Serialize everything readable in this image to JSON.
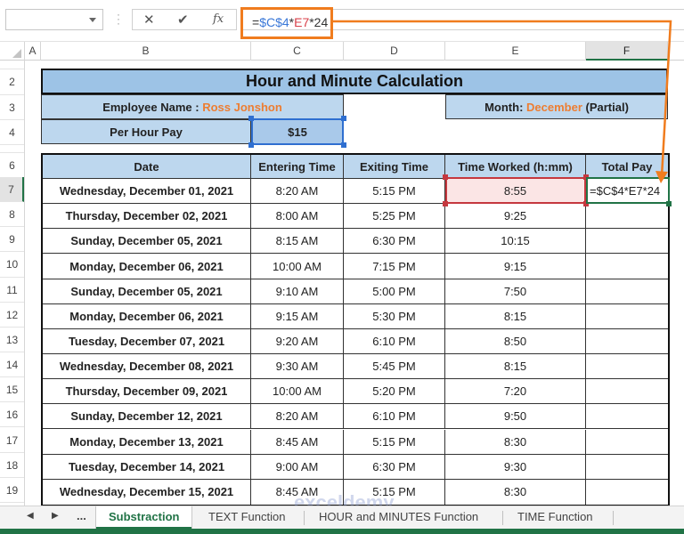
{
  "formula_bar": {
    "name_box_value": "",
    "cancel_icon": "✕",
    "enter_icon": "✔",
    "fx_label": "fx",
    "formula_parts": [
      "=",
      "$C$4",
      "*",
      "E7",
      "*24"
    ]
  },
  "columns": [
    "A",
    "B",
    "C",
    "D",
    "E",
    "F"
  ],
  "selected_column": "F",
  "rows": [
    "2",
    "3",
    "4",
    "6",
    "7",
    "8",
    "9",
    "10",
    "11",
    "12",
    "13",
    "14",
    "15",
    "16",
    "17",
    "18",
    "19"
  ],
  "selected_row": "7",
  "sheet": {
    "title": "Hour and Minute Calculation",
    "employee_label": "Employee Name : ",
    "employee_name": "Ross Jonshon",
    "month_label": "Month: ",
    "month_value": "December",
    "month_suffix": " (Partial)",
    "per_hour_label": "Per Hour Pay",
    "per_hour_value": "$15",
    "headers": [
      "Date",
      "Entering Time",
      "Exiting Time",
      "Time Worked (h:mm)",
      "Total Pay"
    ],
    "records": [
      {
        "date": "Wednesday, December 01, 2021",
        "in": "8:20 AM",
        "out": "5:15 PM",
        "worked": "8:55",
        "pay": "=$C$4*E7*24"
      },
      {
        "date": "Thursday, December 02, 2021",
        "in": "8:00 AM",
        "out": "5:25 PM",
        "worked": "9:25",
        "pay": ""
      },
      {
        "date": "Sunday, December 05, 2021",
        "in": "8:15 AM",
        "out": "6:30 PM",
        "worked": "10:15",
        "pay": ""
      },
      {
        "date": "Monday, December 06, 2021",
        "in": "10:00 AM",
        "out": "7:15 PM",
        "worked": "9:15",
        "pay": ""
      },
      {
        "date": "Sunday, December 05, 2021",
        "in": "9:10 AM",
        "out": "5:00 PM",
        "worked": "7:50",
        "pay": ""
      },
      {
        "date": "Monday, December 06, 2021",
        "in": "9:15 AM",
        "out": "5:30 PM",
        "worked": "8:15",
        "pay": ""
      },
      {
        "date": "Tuesday, December 07, 2021",
        "in": "9:20 AM",
        "out": "6:10 PM",
        "worked": "8:50",
        "pay": ""
      },
      {
        "date": "Wednesday, December 08, 2021",
        "in": "9:30 AM",
        "out": "5:45 PM",
        "worked": "8:15",
        "pay": ""
      },
      {
        "date": "Thursday, December 09, 2021",
        "in": "10:00 AM",
        "out": "5:20 PM",
        "worked": "7:20",
        "pay": ""
      },
      {
        "date": "Sunday, December 12, 2021",
        "in": "8:20 AM",
        "out": "6:10 PM",
        "worked": "9:50",
        "pay": ""
      },
      {
        "date": "Monday, December 13, 2021",
        "in": "8:45 AM",
        "out": "5:15 PM",
        "worked": "8:30",
        "pay": ""
      },
      {
        "date": "Tuesday, December 14, 2021",
        "in": "9:00 AM",
        "out": "6:30 PM",
        "worked": "9:30",
        "pay": ""
      },
      {
        "date": "Wednesday, December 15, 2021",
        "in": "8:45 AM",
        "out": "5:15 PM",
        "worked": "8:30",
        "pay": ""
      }
    ]
  },
  "tabs": {
    "prev_icon": "◀",
    "next_icon": "▶",
    "more_label": "...",
    "items": [
      "Substraction",
      "TEXT Function",
      "HOUR and MINUTES Function",
      "TIME Function"
    ],
    "active": "Substraction"
  },
  "watermark": "exceldemy",
  "colors": {
    "accent_orange": "#f07c1e",
    "excel_green": "#217346",
    "header_blue": "#9dc3e6",
    "cell_blue": "#bdd7ee",
    "ref_blue": "#3a78d8",
    "ref_red": "#d8404a",
    "name_orange": "#ed7d31"
  }
}
